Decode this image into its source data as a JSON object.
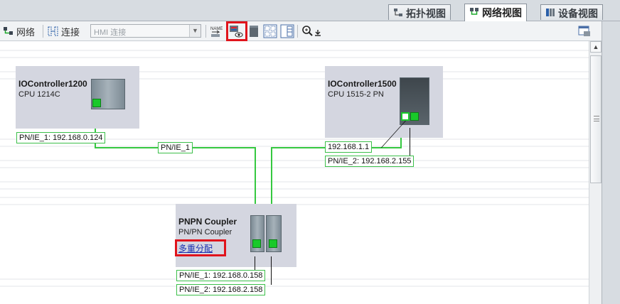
{
  "tabs": {
    "topology": "拓扑视图",
    "network": "网络视图",
    "device": "设备视图"
  },
  "toolbar": {
    "network_label": "网络",
    "connect_label": "连接",
    "hmi_select_value": "HMI 连接",
    "icons": [
      "network-icon",
      "connection-icon",
      "name-icon",
      "show-address-icon",
      "module-icon",
      "grid-icon",
      "table-icon",
      "zoom-icon",
      "download-icon",
      "window-toggle-icon"
    ]
  },
  "devices": {
    "plc1200": {
      "name": "IOController1200",
      "type": "CPU 1214C"
    },
    "plc1500": {
      "name": "IOController1500",
      "type": "CPU 1515-2 PN"
    },
    "coupler": {
      "name": "PNPN Coupler",
      "type": "PN/PN Coupler",
      "link": "多重分配"
    }
  },
  "labels": {
    "plc1200_port": "PN/IE_1:  192.168.0.124",
    "subnet": "PN/IE_1",
    "plc1500_ip": "192.168.1.1",
    "plc1500_port": "PN/IE_2:  192.168.2.155",
    "coupler_port1": "PN/IE_1:  192.168.0.158",
    "coupler_port2": "PN/IE_2:  192.168.2.158"
  },
  "colors": {
    "highlight": "#e0141c",
    "network_line": "#35c840",
    "device_bg": "#d4d6e0"
  }
}
